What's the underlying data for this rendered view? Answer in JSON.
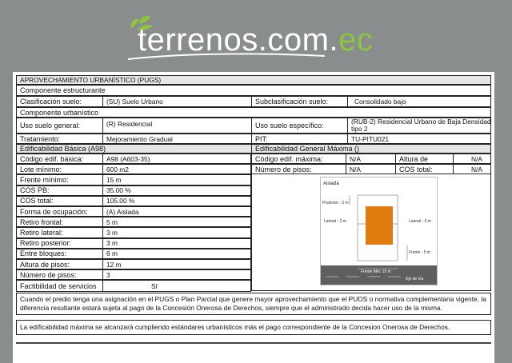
{
  "logo": {
    "text_main": "terrenos.com.",
    "text_ext": "ec",
    "colors": {
      "leaf": "#8cc63f",
      "text": "#ffffff"
    }
  },
  "sheet": {
    "title": "APROVECHAMIENTO URBANÍSTICO (PUGS)",
    "componente_estructurante": "Componente  estructurante",
    "clasificacion_label": "Clasificación suelo:",
    "clasificacion_value": "(SU) Suelo Urbano",
    "subclasificacion_label": "Subclasificación suelo:",
    "subclasificacion_value": "Consolidado bajo",
    "componente_urbanistico": "Componente  urbanístico",
    "uso_general_label": "Uso suelo general:",
    "uso_general_value": "(R) Residencial",
    "uso_especifico_label": "Uso suelo específico:",
    "uso_especifico_value": "(RUB-2) Residencial Urbano de Baja Densidad tipo 2",
    "tratamiento_label": "Tratamiento:",
    "tratamiento_value": "Mejoramiento Gradual",
    "pit_label": "PIT:",
    "pit_value": "TU-PITU021",
    "edif_basica_header": "Edificabilidad Básica (A98)",
    "edif_general_header": "Edificabilidad General Máxima ()",
    "left_rows": [
      {
        "label": "Código edif. básica:",
        "value": "A98 (A603-35)"
      },
      {
        "label": "Lote mínimo:",
        "value": "600 m2"
      },
      {
        "label": "Frente mínimo:",
        "value": "15 m"
      },
      {
        "label": "COS PB:",
        "value": "35.00 %"
      },
      {
        "label": "COS total:",
        "value": "105.00 %"
      },
      {
        "label": "Forma de ocupación:",
        "value": "(A) Aislada"
      },
      {
        "label": "Retiro frontal:",
        "value": "5 m"
      },
      {
        "label": "Retiro lateral:",
        "value": "3 m"
      },
      {
        "label": "Retiro posterior:",
        "value": "3 m"
      },
      {
        "label": "Entre bloques:",
        "value": "6 m"
      },
      {
        "label": "Altura de pisos:",
        "value": "12 m"
      },
      {
        "label": "Número de pisos:",
        "value": "3"
      },
      {
        "label": "Factibilidad de servicios",
        "value": "SI"
      }
    ],
    "right_rows": {
      "codigo_max_label": "Código edif. máxima:",
      "codigo_max_value": "N/A",
      "altura_label": "Altura de",
      "altura_value": "N/A",
      "num_pisos_label": "Número de pisos:",
      "num_pisos_value": "N/A",
      "cos_total_label": "COS total:",
      "cos_total_value": "N/A"
    },
    "diagram": {
      "title": "Aislada",
      "posterior": "Posterior : 3 m",
      "lateral_left": "Lateral : 3 m",
      "lateral_right": "Lateral : 3 m",
      "frente": "Frente : 5 m",
      "frente_min": "Frente Min: 15 m",
      "eje_via": "Eje de vía",
      "building_color": "#e07b10",
      "road_color": "#5e5f5f"
    },
    "paragraph1": "Cuando el predio tenga una asignación en el PUGS o Plan Parcial que genere mayor aprovechamiento que el PUOS o normativa complementaria vigente, la diferencia resultante estará sujeta al pago de la Concesión Onerosa de Derechos, siempre que el administrado decida hacer uso de la misma.",
    "paragraph2": "La edificabilidad máxima se alcanzará cumpliendo estándares urbanísticos más el pago correspondiente de la Concesion Onerosa de Derechos."
  }
}
